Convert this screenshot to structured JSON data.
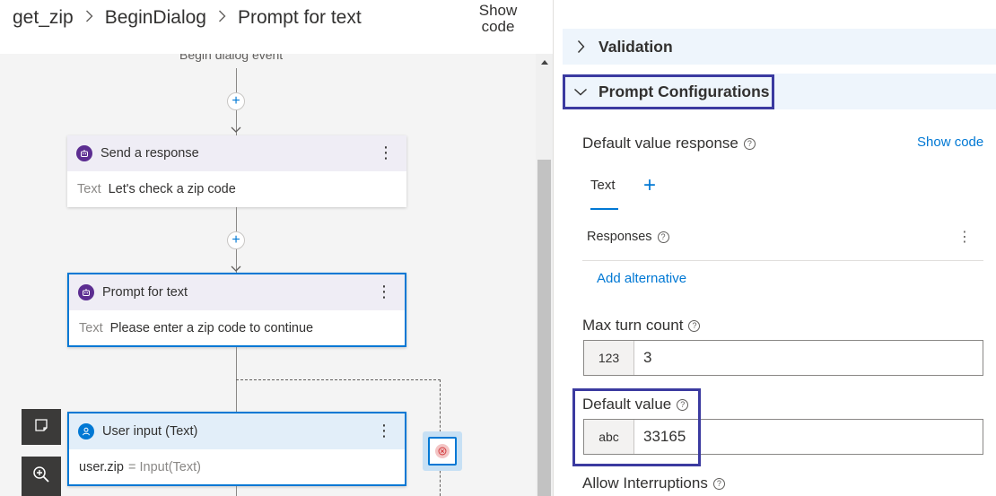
{
  "breadcrumb": {
    "items": [
      "get_zip",
      "BeginDialog",
      "Prompt for text"
    ]
  },
  "header": {
    "show_code_label_line1": "Show",
    "show_code_label_line2": "code"
  },
  "canvas": {
    "event_label": "Begin dialog event",
    "add_symbol": "+",
    "nodes": [
      {
        "title": "Send a response",
        "body_key": "Text",
        "body_value": "Let's check a zip code",
        "icon": "bot-icon"
      },
      {
        "title": "Prompt for text",
        "body_key": "Text",
        "body_value": "Please enter a zip code to continue",
        "icon": "bot-icon"
      },
      {
        "title": "User input (Text)",
        "body_key": "user.zip",
        "body_value": "= Input(Text)",
        "icon": "person-icon"
      }
    ],
    "menu_symbol": "⋮"
  },
  "tools": {
    "comment_icon": "comment-icon",
    "zoom_icon": "zoom-in-icon"
  },
  "properties": {
    "validation_label": "Validation",
    "prompt_config_label": "Prompt Configurations",
    "default_value_response_label": "Default value response",
    "show_code_label": "Show code",
    "tab_text_label": "Text",
    "tab_add_symbol": "+",
    "responses_label": "Responses",
    "add_alternative_label": "Add alternative",
    "max_turn_count_label": "Max turn count",
    "max_turn_count_type": "123",
    "max_turn_count_value": "3",
    "default_value_label": "Default value",
    "default_value_type": "abc",
    "default_value_value": "33165",
    "allow_interruptions_label": "Allow Interruptions"
  },
  "colors": {
    "accent": "#0078d4",
    "highlight_border": "#3b3aa0",
    "bot_icon": "#5c2d91"
  }
}
